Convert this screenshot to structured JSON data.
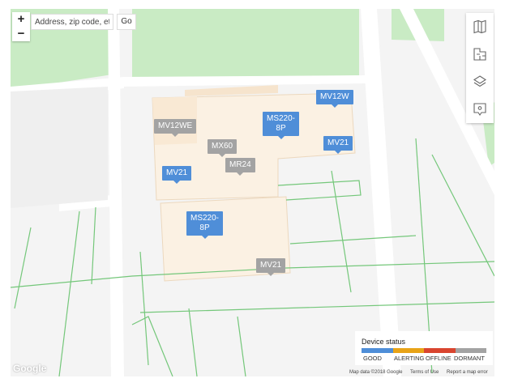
{
  "search": {
    "placeholder": "Address, zip code, etc.",
    "go_label": "Go"
  },
  "zoom": {
    "in_label": "+",
    "out_label": "−"
  },
  "toolbar": [
    {
      "icon": "map-icon"
    },
    {
      "icon": "floorplan-icon"
    },
    {
      "icon": "layers-icon"
    },
    {
      "icon": "tag-icon"
    }
  ],
  "devices": [
    {
      "label": "MV12W",
      "status": "good"
    },
    {
      "label": "MV12WE",
      "status": "dormant"
    },
    {
      "label": "MS220-\n8P",
      "status": "good"
    },
    {
      "label": "MX60",
      "status": "dormant"
    },
    {
      "label": "MV21",
      "status": "good"
    },
    {
      "label": "MV21",
      "status": "good"
    },
    {
      "label": "MR24",
      "status": "dormant"
    },
    {
      "label": "MS220-\n8P",
      "status": "good"
    },
    {
      "label": "MV21",
      "status": "dormant"
    }
  ],
  "legend": {
    "title": "Device status",
    "items": [
      {
        "label": "GOOD",
        "color": "#4f8ed8"
      },
      {
        "label": "ALERTING",
        "color": "#e8a317"
      },
      {
        "label": "OFFLINE",
        "color": "#d9452f"
      },
      {
        "label": "DORMANT",
        "color": "#a3a3a3"
      }
    ]
  },
  "attribution": {
    "logo": "Google",
    "map_data": "Map data ©2018 Google",
    "terms": "Terms of Use",
    "report": "Report a map error"
  }
}
